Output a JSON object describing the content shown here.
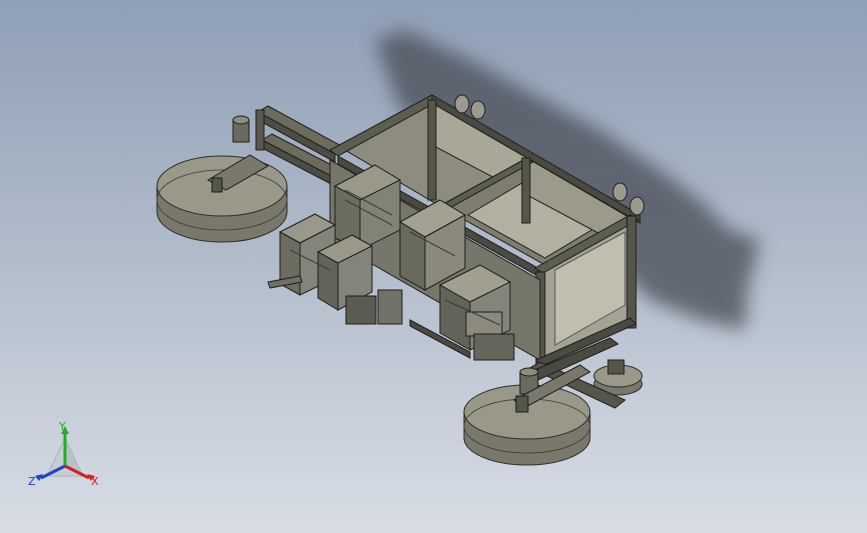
{
  "viewport": {
    "background_top": "#8f9fb6",
    "background_bottom": "#d8dde5"
  },
  "model": {
    "description_icon": "machine-assembly-icon",
    "frame_color": "#55554a",
    "panel_color": "#8e8c7e",
    "disc_color": "#9a9889"
  },
  "triad": {
    "x_label": "X",
    "y_label": "Y",
    "z_label": "Z",
    "x_color": "#d02020",
    "y_color": "#20b020",
    "z_color": "#2040d0"
  }
}
